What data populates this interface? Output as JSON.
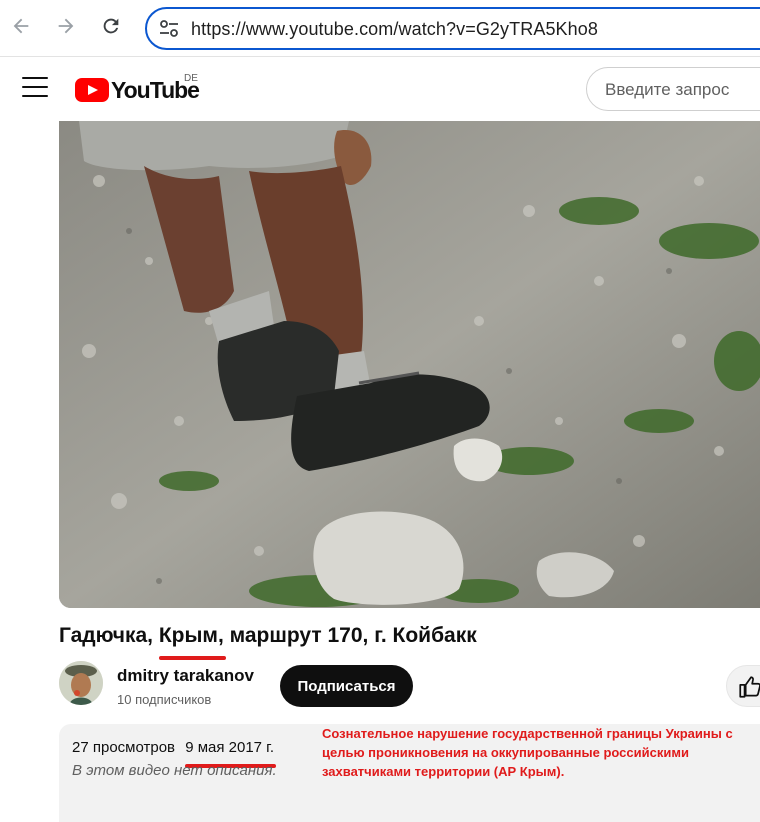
{
  "browser": {
    "url": "https://www.youtube.com/watch?v=G2yTRA5Kho8"
  },
  "header": {
    "logo_text": "YouTube",
    "region": "DE",
    "search_placeholder": "Введите запрос"
  },
  "video": {
    "title_prefix": "Гадючка, ",
    "title_highlight": "Крым,",
    "title_suffix": " маршрут 170, г. Койбакк"
  },
  "channel": {
    "name": "dmitry tarakanov",
    "subscribers": "10 подписчиков",
    "subscribe_label": "Подписаться"
  },
  "description": {
    "views": "27 просмотров",
    "date": "9 мая 2017 г.",
    "empty_text": "В этом видео нет описания."
  },
  "annotation": {
    "text": "Сознательное нарушение государственной границы Украины с целью проникновения на оккупированные российскими захватчиками территории (АР Крым)."
  },
  "colors": {
    "accent_blue": "#0b57d0",
    "youtube_red": "#ff0000",
    "annotation_red": "#e01b1b"
  }
}
